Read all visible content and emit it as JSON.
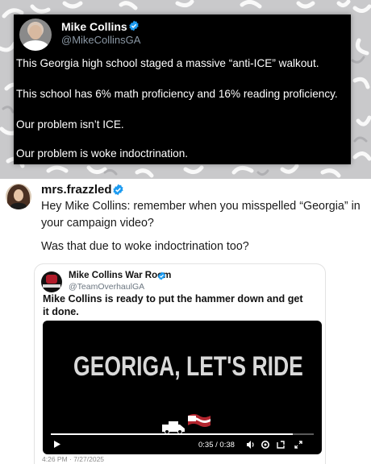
{
  "embedded_tweet": {
    "author_name": "Mike Collins",
    "author_handle": "@MikeCollinsGA",
    "lines": [
      "This Georgia high school staged a massive “anti-ICE” walkout.",
      "This school has 6% math proficiency and 16% reading proficiency.",
      "Our problem isn’t ICE.",
      "Our problem is woke indoctrination."
    ]
  },
  "reply": {
    "author_name": "mrs.frazzled",
    "lines": [
      "Hey Mike Collins: remember when you misspelled “Georgia” in",
      "your campaign video?",
      "Was that due to woke indoctrination too?"
    ]
  },
  "quoted": {
    "author_name": "Mike Collins War Room",
    "author_handle": "@TeamOverhaulGA",
    "text_lines": [
      "Mike Collins is ready to put the hammer down and get",
      "it done."
    ],
    "video": {
      "title": "GEORIGA, LET'S RIDE",
      "time": "0:35 / 0:38",
      "progress": 0.92
    },
    "timestamp": "4:26 PM · 7/27/2025"
  },
  "colors": {
    "verified": "#1d9bf0",
    "pattern_bg": "#c9c9cb"
  },
  "icons": [
    "verified-badge-icon",
    "play-icon",
    "volume-icon",
    "settings-icon",
    "pip-icon",
    "fullscreen-icon",
    "truck-flag-icon"
  ]
}
